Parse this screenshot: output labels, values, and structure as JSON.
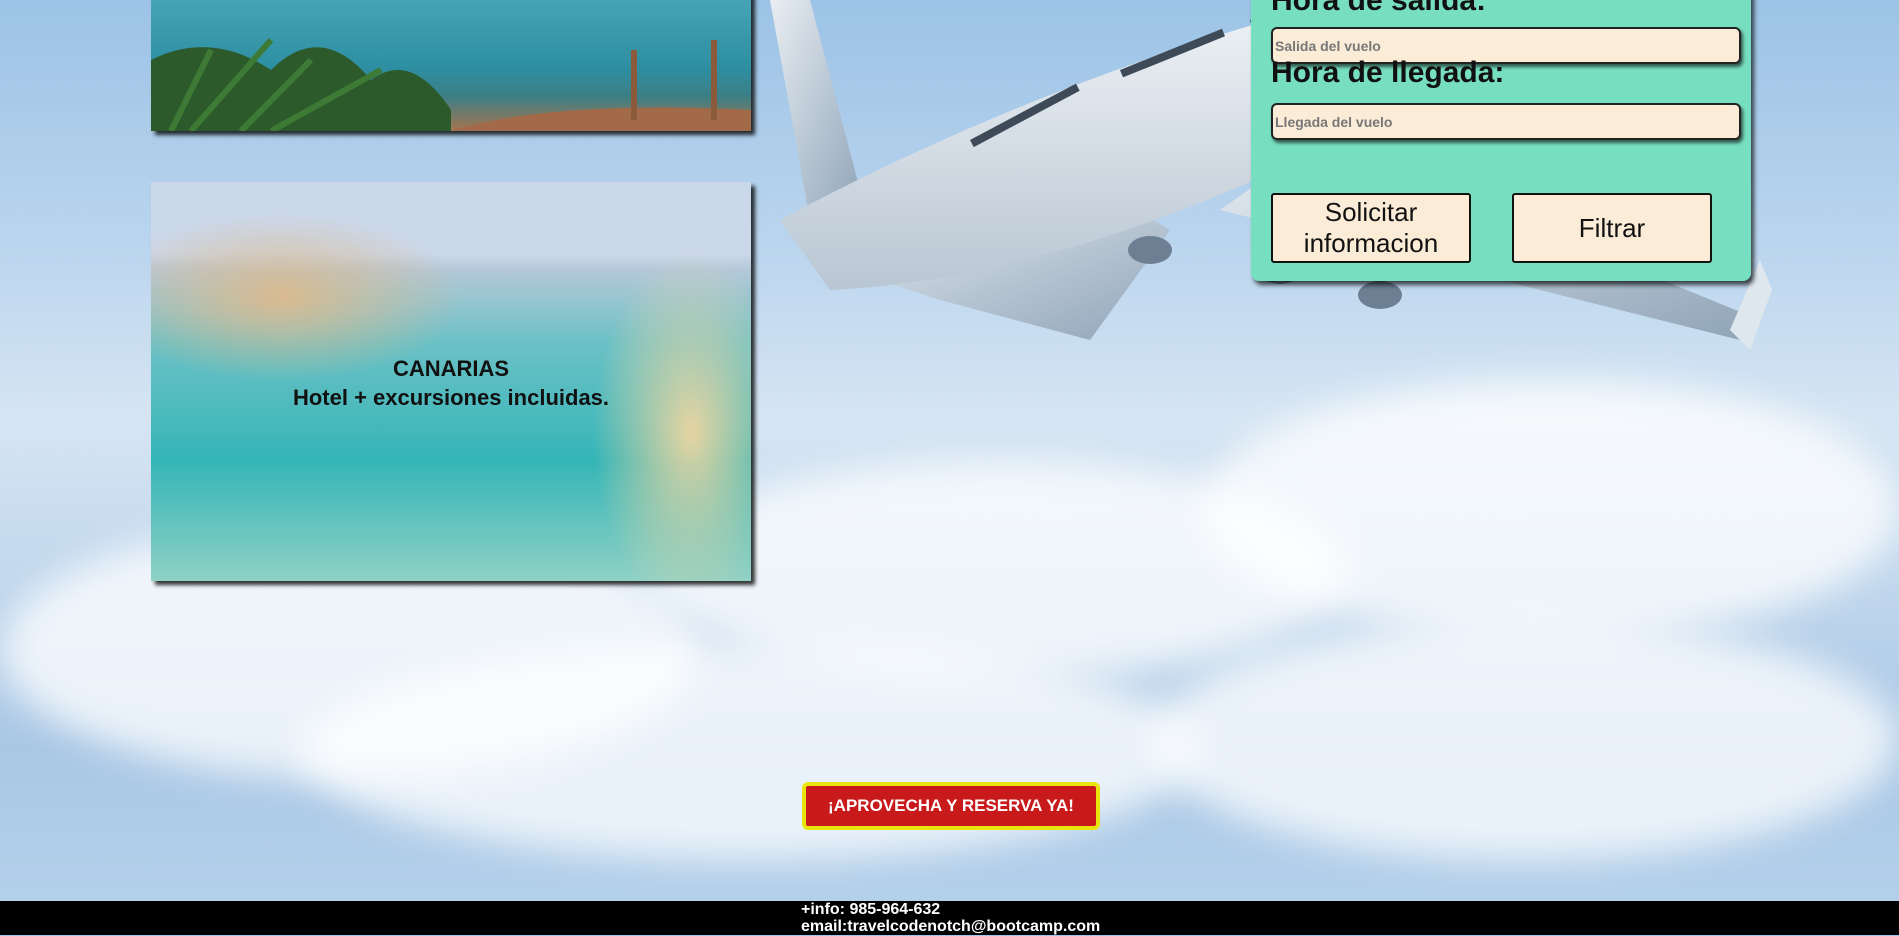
{
  "cards": [
    {
      "title": "",
      "subtitle": ""
    },
    {
      "title": "CANARIAS",
      "subtitle": "Hotel + excursiones incluidas."
    }
  ],
  "form": {
    "departure_label": "Hora de salida:",
    "departure_placeholder": "Salida del vuelo",
    "arrival_label": "Hora de llegada:",
    "arrival_placeholder": "Llegada del vuelo",
    "request_info_button": "Solicitar informacion",
    "filter_button": "Filtrar"
  },
  "cta_button": "¡APROVECHA Y RESERVA YA!",
  "footer": {
    "phone": "+info: 985-964-632",
    "email": "email:travelcodenotch@bootcamp.com"
  },
  "colors": {
    "form_panel": "#77dfc0",
    "input_bg": "#fbecd8",
    "cta_bg": "#c81a1a",
    "cta_border": "#e8e40e",
    "footer_bg": "#000000"
  }
}
